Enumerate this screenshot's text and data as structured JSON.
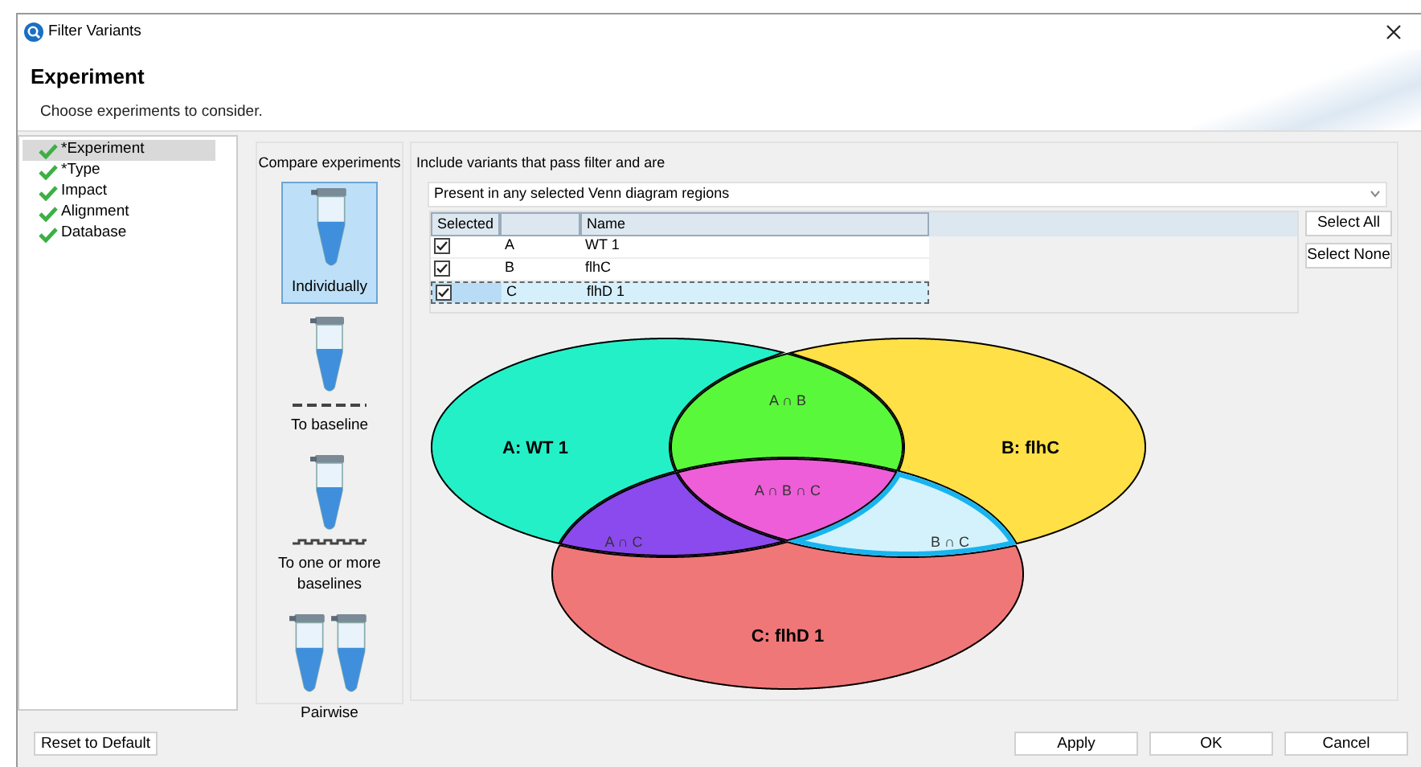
{
  "window": {
    "title": "Filter Variants"
  },
  "header": {
    "title": "Experiment",
    "subtitle": "Choose experiments to consider."
  },
  "sidebar": {
    "items": [
      {
        "label": "*Experiment",
        "checked": true,
        "selected": true
      },
      {
        "label": "*Type",
        "checked": true,
        "selected": false
      },
      {
        "label": "Impact",
        "checked": true,
        "selected": false
      },
      {
        "label": "Alignment",
        "checked": true,
        "selected": false
      },
      {
        "label": "Database",
        "checked": true,
        "selected": false
      }
    ]
  },
  "compare": {
    "title": "Compare experiments",
    "options": [
      {
        "kind": "single",
        "label": "Individually",
        "selected": true
      },
      {
        "kind": "baseline",
        "label": "To baseline",
        "selected": false
      },
      {
        "kind": "baselines",
        "label": "To one or more baselines",
        "selected": false
      },
      {
        "kind": "pairwise",
        "label": "Pairwise",
        "selected": false
      }
    ]
  },
  "include": {
    "title": "Include variants that pass filter and are",
    "dropdown": "Present in any selected Venn diagram regions"
  },
  "table": {
    "columns": [
      "Selected",
      "",
      "Name"
    ],
    "rows": [
      {
        "checked": true,
        "letter": "A",
        "name": "WT 1",
        "selected": false
      },
      {
        "checked": true,
        "letter": "B",
        "name": "flhC",
        "selected": false
      },
      {
        "checked": true,
        "letter": "C",
        "name": "flhD 1",
        "selected": true
      }
    ]
  },
  "table_buttons": [
    "Select All",
    "Select None"
  ],
  "venn": {
    "sets": [
      {
        "label": "A: WT 1",
        "color": "#24f0c8"
      },
      {
        "label": "B: flhC",
        "color": "#ffe047"
      },
      {
        "label": "C: flhD 1",
        "color": "#f07777"
      }
    ],
    "regions": [
      {
        "label": "A ∩ B",
        "color": "#5af83a",
        "selected": false
      },
      {
        "label": "A ∩ C",
        "color": "#8a4aee",
        "selected": false
      },
      {
        "label": "B ∩ C",
        "color": "#d4f2fc",
        "selected": true
      },
      {
        "label": "A ∩ B ∩ C",
        "color": "#ee5ed8",
        "selected": false
      }
    ]
  },
  "footer": {
    "reset": "Reset to Default",
    "buttons": [
      "Apply",
      "OK",
      "Cancel"
    ]
  }
}
